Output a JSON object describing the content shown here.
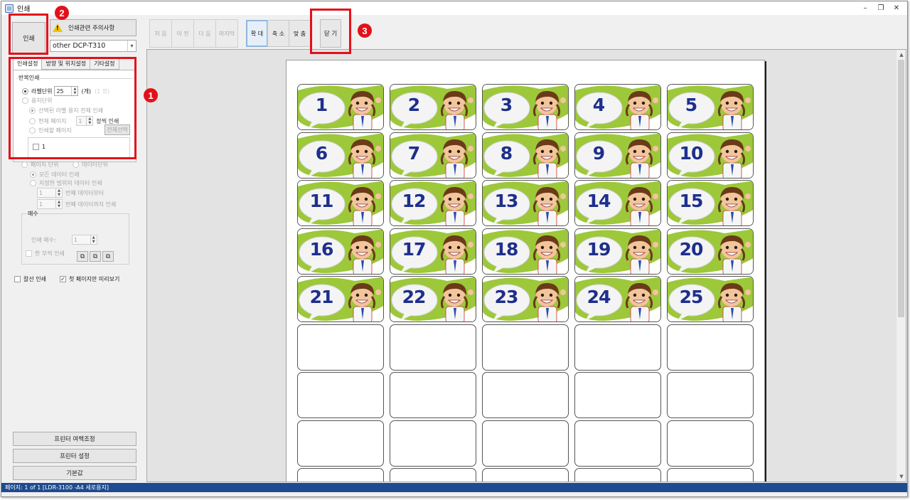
{
  "window": {
    "title": "인쇄",
    "controls": [
      "minimize",
      "restore",
      "close"
    ]
  },
  "left": {
    "print_button": "인쇄",
    "notice_button": "인쇄관련 주의사항",
    "printer": "other DCP-T310",
    "tabs": [
      {
        "label": "인쇄설정",
        "active": true
      },
      {
        "label": "방향 및 위치설정",
        "active": false
      },
      {
        "label": "기타설정",
        "active": false
      }
    ],
    "repeat_group": "반복인쇄",
    "label_unit": "라벨단위",
    "label_unit_value": "25",
    "label_unit_suffix": "(개)",
    "label_unit_faded": "(1 장)",
    "sheet_unit": "용지단위",
    "opt_selected_all": "선택된 라벨 용지 전체 인쇄",
    "opt_current_page": "현재 페이지",
    "current_page_value": "1",
    "current_page_suffix": "장씩 인쇄",
    "opt_print_pages": "인쇄할 페이지",
    "select_all_button": "전체선택",
    "page_list_item": "1",
    "page_unit": "페이지 단위",
    "data_unit": "데이터단위",
    "opt_all_data": "모든 데이터 인쇄",
    "opt_range_data": "지정한 범위의 데이터 인쇄",
    "range_from_value": "1",
    "range_from_suffix": "번째 데이터부터",
    "range_to_value": "1",
    "range_to_suffix": "번째 데이터까지 인쇄",
    "copies_group": "매수",
    "copies_label": "인쇄 매수:",
    "copies_value": "1",
    "one_by_one": "한 부씩 인쇄",
    "cut_line": "칼선 인쇄",
    "first_page_preview": "첫 페이지만 미리보기",
    "first_page_checked": true,
    "printer_margin_button": "프린터 여백조정",
    "printer_settings_button": "프린터 설정",
    "defaults_button": "기본값"
  },
  "toolbar": {
    "nav": [
      "처 음",
      "이 전",
      "다 음",
      "마지막"
    ],
    "zoom": [
      "확 대",
      "축 소",
      "맞 춤"
    ],
    "close": "닫 기"
  },
  "preview": {
    "labels": [
      "1",
      "2",
      "3",
      "4",
      "5",
      "6",
      "7",
      "8",
      "9",
      "10",
      "11",
      "12",
      "13",
      "14",
      "15",
      "16",
      "17",
      "18",
      "19",
      "20",
      "21",
      "22",
      "23",
      "24",
      "25"
    ],
    "columns": 5,
    "total_rows_visible": 9,
    "label_number_color": "#1e2f8c",
    "label_bg_color": "#9cc83a"
  },
  "status": {
    "text": "페이지: 1 of 1 [LDR-3100 -A4 세로용지]"
  },
  "annotations": {
    "markers": [
      "1",
      "2",
      "3"
    ],
    "color": "#e3101a"
  }
}
